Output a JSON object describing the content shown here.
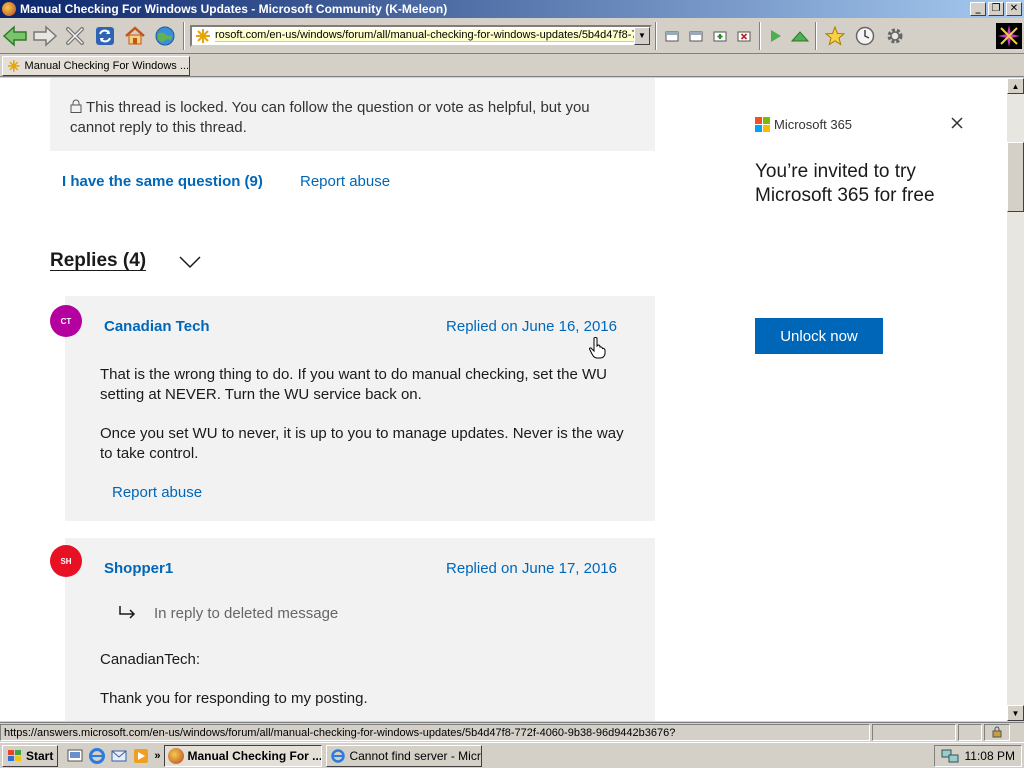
{
  "window": {
    "title": "Manual Checking For Windows Updates - Microsoft Community (K-Meleon)"
  },
  "toolbar": {
    "url": "rosoft.com/en-us/windows/forum/all/manual-checking-for-windows-updates/5b4d47f8-772"
  },
  "tabs": [
    {
      "label": "Manual Checking For Windows ..."
    }
  ],
  "page": {
    "locked_notice": "This thread is locked. You can follow the question or vote as helpful, but you cannot reply to this thread.",
    "same_question_label": "I have the same question (9)",
    "report_abuse_label": "Report abuse",
    "replies_heading": "Replies (4)",
    "replies": [
      {
        "avatar_initials": "CT",
        "avatar_color": "#b4009e",
        "author": "Canadian Tech",
        "date": "Replied on June 16, 2016",
        "paragraphs": [
          "That is the wrong thing to do.  If you want to do manual checking, set the WU setting at NEVER.  Turn the WU service back on.",
          "Once you set WU to never, it is up to you to manage updates.  Never is the way to take control."
        ],
        "report_abuse_label": "Report abuse"
      },
      {
        "avatar_initials": "SH",
        "avatar_color": "#e81123",
        "author": "Shopper1",
        "date": "Replied on June 17, 2016",
        "in_reply_to": "In reply to deleted message",
        "paragraphs": [
          "CanadianTech:",
          "Thank you for responding to my posting."
        ]
      }
    ]
  },
  "ad": {
    "brand": "Microsoft 365",
    "headline": "You’re invited to try Microsoft 365 for free",
    "cta_label": "Unlock now",
    "accent_color": "#0067b8"
  },
  "statusbar": {
    "url": "https://answers.microsoft.com/en-us/windows/forum/all/manual-checking-for-windows-updates/5b4d47f8-772f-4060-9b38-96d9442b3676?"
  },
  "taskbar": {
    "start_label": "Start",
    "tasks": [
      {
        "label": "Manual Checking For ...",
        "active": true
      },
      {
        "label": "Cannot find server - Micros...",
        "active": false
      }
    ],
    "clock": "11:08 PM"
  }
}
